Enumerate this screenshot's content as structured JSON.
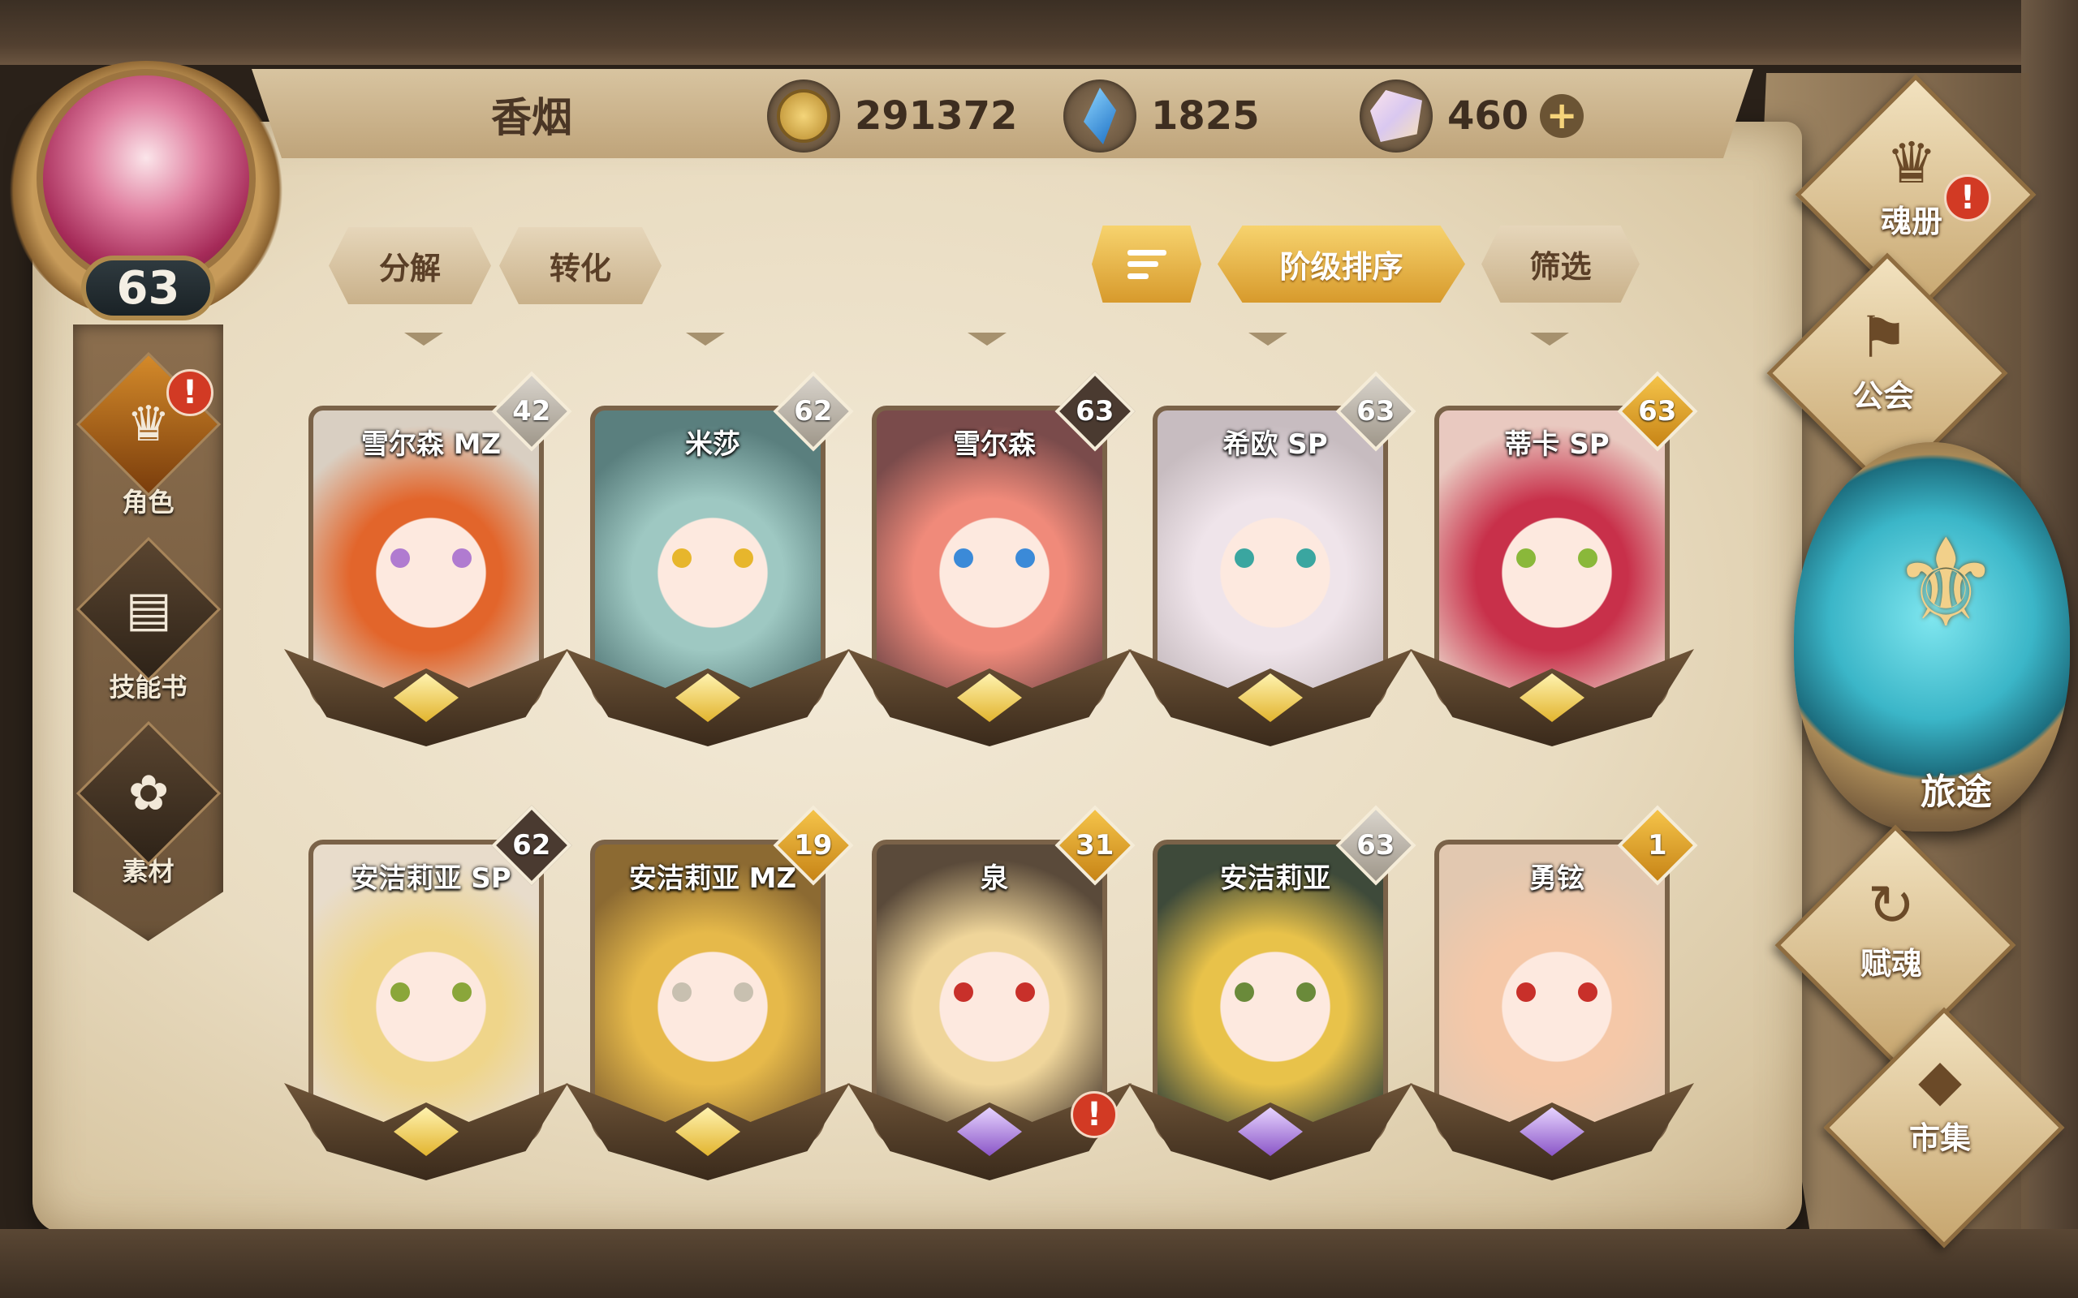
{
  "player": {
    "name": "香烟",
    "level": "63"
  },
  "currencies": [
    {
      "icon": "gold-coin-icon",
      "value": "291372"
    },
    {
      "icon": "blue-crystal-icon",
      "value": "1825"
    },
    {
      "icon": "soul-gem-icon",
      "value": "460"
    }
  ],
  "left_nav": [
    {
      "label": "角色",
      "icon": "helmet-icon",
      "alert": "!"
    },
    {
      "label": "技能书",
      "icon": "skill-book-icon"
    },
    {
      "label": "素材",
      "icon": "material-icon"
    }
  ],
  "actions": {
    "decompose": "分解",
    "convert": "转化",
    "sort_by_rank": "阶级排序",
    "filter": "筛选"
  },
  "cards": [
    {
      "name": "雪尔森 MZ",
      "level": "42",
      "badge": "silver",
      "hair": "#e2652b",
      "bg": "#d9cfc2",
      "eye": "#b07bd0",
      "crest": "gold"
    },
    {
      "name": "米莎",
      "level": "62",
      "badge": "silver",
      "hair": "#9ec8c2",
      "bg": "#5a7f7e",
      "eye": "#e7b62c",
      "crest": "gold"
    },
    {
      "name": "雪尔森",
      "level": "63",
      "badge": "dark",
      "hair": "#f08a7a",
      "bg": "#7a4b4b",
      "eye": "#3b8ad8",
      "crest": "gold"
    },
    {
      "name": "希欧 SP",
      "level": "63",
      "badge": "silver",
      "hair": "#efe4ea",
      "bg": "#c7bcc0",
      "eye": "#3aa6a0",
      "crest": "gold"
    },
    {
      "name": "蒂卡 SP",
      "level": "63",
      "badge": "gold",
      "hair": "#c8304a",
      "bg": "#e9c9c0",
      "eye": "#8ab83a",
      "crest": "gold"
    },
    {
      "name": "安洁莉亚 SP",
      "level": "62",
      "badge": "dark",
      "hair": "#efd58a",
      "bg": "#e8dccb",
      "eye": "#8aa63a",
      "crest": "gold"
    },
    {
      "name": "安洁莉亚 MZ",
      "level": "19",
      "badge": "gold",
      "hair": "#e6b94a",
      "bg": "#8c6a32",
      "eye": "#c8c0b0",
      "crest": "gold"
    },
    {
      "name": "泉",
      "level": "31",
      "badge": "gold",
      "hair": "#efd59a",
      "bg": "#5a4a3a",
      "eye": "#c8302a",
      "crest": "purple",
      "alert": "!"
    },
    {
      "name": "安洁莉亚",
      "level": "63",
      "badge": "silver",
      "hair": "#e8c24a",
      "bg": "#3e4a3a",
      "eye": "#6a8a3a",
      "crest": "purple"
    },
    {
      "name": "勇铉",
      "level": "1",
      "badge": "gold",
      "hair": "#f5c8a8",
      "bg": "#e2c8b0",
      "eye": "#c8302a",
      "crest": "purple"
    }
  ],
  "right_menu": [
    {
      "label": "魂册",
      "icon": "soul-book-icon",
      "alert": "!"
    },
    {
      "label": "公会",
      "icon": "guild-banner-icon"
    },
    {
      "label": "旅途",
      "icon": "journey-emblem-icon"
    },
    {
      "label": "赋魂",
      "icon": "soul-swirl-icon"
    },
    {
      "label": "市集",
      "icon": "market-gem-icon"
    }
  ]
}
